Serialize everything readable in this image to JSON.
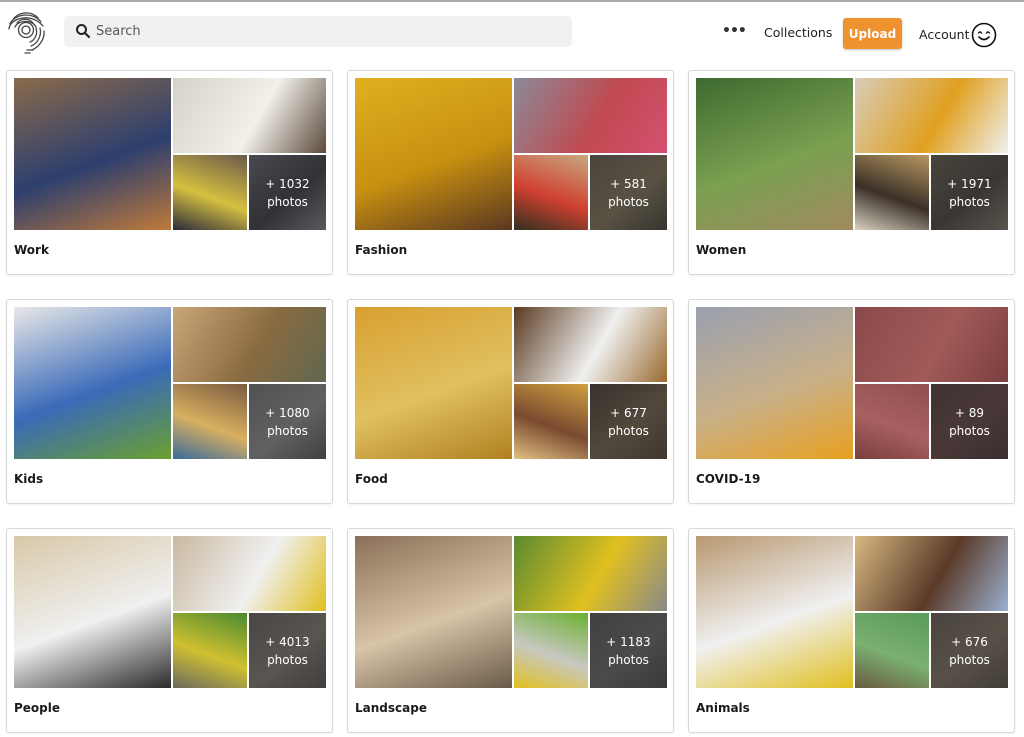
{
  "header": {
    "logo": "fingerprint-africa-logo",
    "search": {
      "placeholder": "Search",
      "value": "",
      "icon": "search-icon"
    },
    "more_label": "•••",
    "collections_label": "Collections",
    "upload_label": "Upload",
    "account_label": "Account",
    "account_icon": "smiley-icon",
    "accent_color": "#f0912f"
  },
  "collections": [
    {
      "title": "Work",
      "more_count": "+ 1032 photos",
      "colors": {
        "main": [
          "#8a6a4a",
          "#2d3f6e",
          "#c07a3a"
        ],
        "tr": [
          "#d6d2c8",
          "#f2f0ea",
          "#5b4a3c"
        ],
        "bl": [
          "#6a5a4a",
          "#d6c040",
          "#2a2a3a"
        ],
        "br": [
          "#6a6a78",
          "#3a3a44",
          "#8a8a94"
        ]
      }
    },
    {
      "title": "Fashion",
      "more_count": "+ 581 photos",
      "colors": {
        "main": [
          "#e0b020",
          "#c89010",
          "#5a3820"
        ],
        "tr": [
          "#8a8a98",
          "#c04a50",
          "#d45070"
        ],
        "bl": [
          "#c8a880",
          "#d04030",
          "#303020"
        ],
        "br": [
          "#6a6050",
          "#8a7c60",
          "#4a4438"
        ]
      }
    },
    {
      "title": "Women",
      "more_count": "+ 1971 photos",
      "colors": {
        "main": [
          "#3e6a30",
          "#7aa050",
          "#a08a60"
        ],
        "tr": [
          "#d8ccb8",
          "#e0a020",
          "#f0f0ee"
        ],
        "bl": [
          "#b89860",
          "#3a3028",
          "#d8d0c0"
        ],
        "br": [
          "#6a6050",
          "#4a4440",
          "#8a8070"
        ]
      }
    },
    {
      "title": "Kids",
      "more_count": "+ 1080 photos",
      "colors": {
        "main": [
          "#e8e8e8",
          "#3a6ab8",
          "#6aa030"
        ],
        "tr": [
          "#c8a878",
          "#8a6a40",
          "#606850"
        ],
        "bl": [
          "#7a5a40",
          "#d8b060",
          "#3a6a9a"
        ],
        "br": [
          "#7a7a80",
          "#9a9aa0",
          "#5a5a60"
        ]
      }
    },
    {
      "title": "Food",
      "more_count": "+ 677 photos",
      "colors": {
        "main": [
          "#d8a030",
          "#e0c060",
          "#b08020"
        ],
        "tr": [
          "#5a3a20",
          "#f0f0f0",
          "#9a6a30"
        ],
        "bl": [
          "#d0a040",
          "#7a4a30",
          "#e0c080"
        ],
        "br": [
          "#4a3a30",
          "#7a6a50",
          "#5a4a3a"
        ]
      }
    },
    {
      "title": "COVID-19",
      "more_count": "+ 89 photos",
      "colors": {
        "main": [
          "#9aa0b0",
          "#c8b088",
          "#e8a020"
        ],
        "tr": [
          "#8a4a4a",
          "#a05a58",
          "#7a3e3e"
        ],
        "bl": [
          "#904e4e",
          "#a86060",
          "#7a3e3e"
        ],
        "br": [
          "#5a3e3e",
          "#6a4848",
          "#4a3434"
        ]
      }
    },
    {
      "title": "People",
      "more_count": "+ 4013 photos",
      "colors": {
        "main": [
          "#d8c8a8",
          "#f0f0f0",
          "#2a2a2a"
        ],
        "tr": [
          "#c8b8a0",
          "#f0f0f0",
          "#e0c020"
        ],
        "bl": [
          "#4a8a30",
          "#d0c030",
          "#6a6a60"
        ],
        "br": [
          "#6a6660",
          "#8a847a",
          "#5a5650"
        ]
      }
    },
    {
      "title": "Landscape",
      "more_count": "+ 1183 photos",
      "colors": {
        "main": [
          "#8a7058",
          "#d8c4a8",
          "#6a5a48"
        ],
        "tr": [
          "#5a8a30",
          "#e0c020",
          "#8a8a88"
        ],
        "bl": [
          "#6ab030",
          "#c8c8c0",
          "#e0c020"
        ],
        "br": [
          "#5a5a58",
          "#6e6e6a",
          "#4a4a48"
        ]
      }
    },
    {
      "title": "Animals",
      "more_count": "+ 676 photos",
      "colors": {
        "main": [
          "#b89870",
          "#f0f0f0",
          "#e0c020"
        ],
        "tr": [
          "#d8b880",
          "#5a3a28",
          "#9ab0d0"
        ],
        "bl": [
          "#5a9a5a",
          "#7ab070",
          "#6a5a40"
        ],
        "br": [
          "#6a6058",
          "#8a7a68",
          "#5a5048"
        ]
      }
    }
  ]
}
